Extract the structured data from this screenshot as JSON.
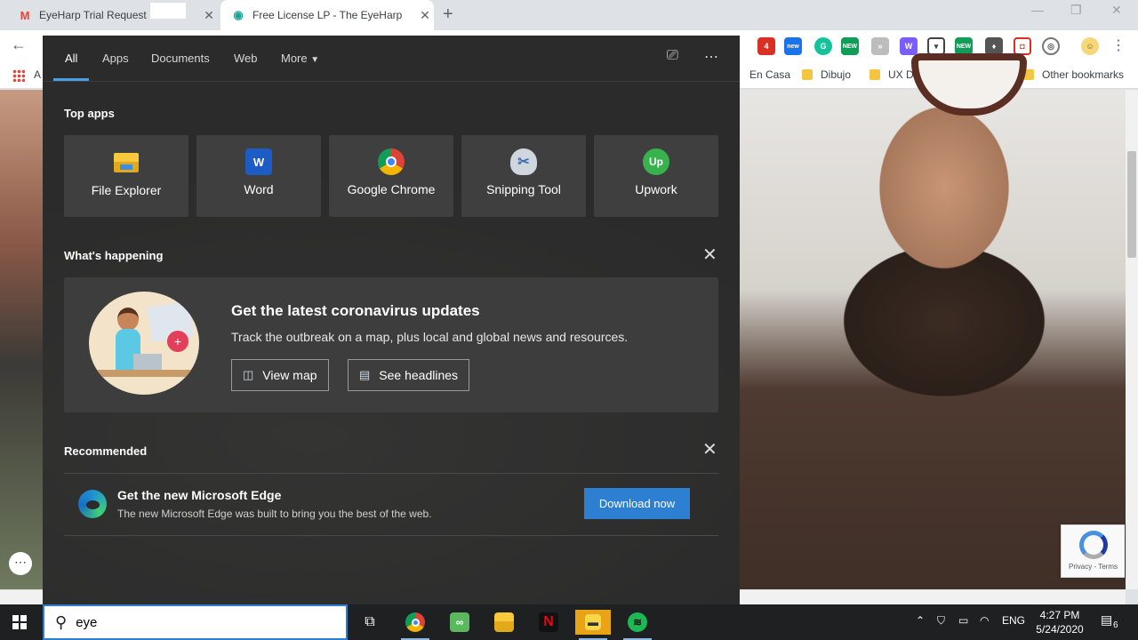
{
  "browser": {
    "tabs": [
      {
        "title": "EyeHarp Trial Request",
        "favicon": "gmail-icon"
      },
      {
        "title": "Free License LP - The EyeHarp",
        "favicon": "eye-icon"
      }
    ],
    "bookmarks": [
      {
        "label": "En Casa",
        "folder": false
      },
      {
        "label": "Dibujo",
        "folder": true
      },
      {
        "label": "UX Design",
        "folder": true
      },
      {
        "label": "»",
        "folder": false
      },
      {
        "label": "Other bookmarks",
        "folder": true
      }
    ],
    "bookmark_partial": "A",
    "extension_badges": {
      "red_count": "4",
      "new1": "new",
      "new2": "NEW",
      "new3": "NEW"
    }
  },
  "search_flyout": {
    "nav_tabs": [
      "All",
      "Apps",
      "Documents",
      "Web",
      "More"
    ],
    "top_apps_title": "Top apps",
    "top_apps": [
      {
        "label": "File Explorer",
        "icon": "file-explorer-icon"
      },
      {
        "label": "Word",
        "icon": "word-icon",
        "glyph": "W"
      },
      {
        "label": "Google Chrome",
        "icon": "chrome-icon"
      },
      {
        "label": "Snipping Tool",
        "icon": "scissors-icon"
      },
      {
        "label": "Upwork",
        "icon": "upwork-icon",
        "glyph": "Up"
      }
    ],
    "whats_happening_title": "What's happening",
    "news": {
      "headline": "Get the latest coronavirus updates",
      "description": "Track the outbreak on a map, plus local and global news and resources.",
      "view_map": "View map",
      "see_headlines": "See headlines"
    },
    "recommended_title": "Recommended",
    "recommended": {
      "title": "Get the new Microsoft Edge",
      "description": "The new Microsoft Edge was built to bring you the best of the web.",
      "button": "Download now"
    }
  },
  "page": {
    "recaptcha_text": "Privacy - Terms"
  },
  "taskbar": {
    "search_value": "eye",
    "language": "ENG",
    "time": "4:27 PM",
    "date": "5/24/2020",
    "notification_count": "6"
  }
}
